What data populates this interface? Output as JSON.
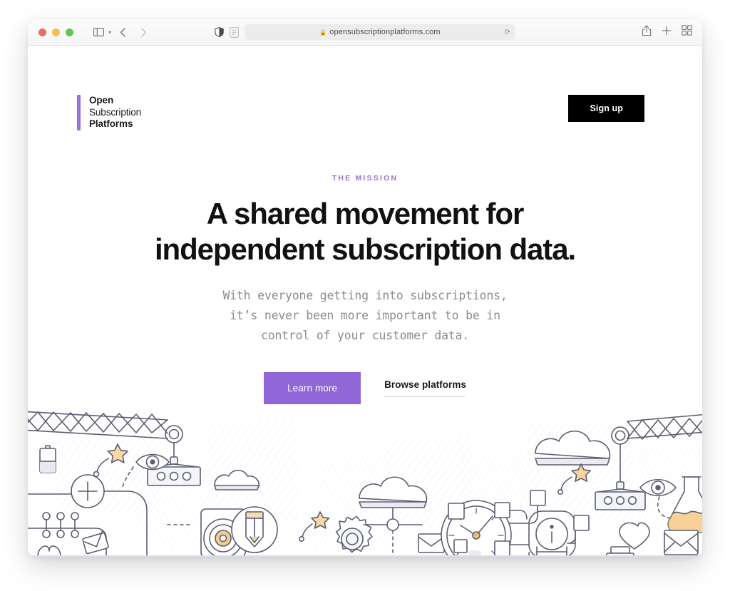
{
  "browser": {
    "traffic_lights": [
      "close",
      "minimize",
      "maximize"
    ],
    "sidebar_toggle_icon": "sidebar-icon",
    "sidebar_chevron_icon": "chevron-down-icon",
    "back_icon": "chevron-left-icon",
    "forward_icon": "chevron-right-icon",
    "privacy_icon": "shield-icon",
    "reader_icon": "reader-mode-icon",
    "url": "opensubscriptionplatforms.com",
    "lock_icon": "lock-icon",
    "reload_icon": "reload-icon",
    "share_icon": "share-icon",
    "new_tab_icon": "plus-icon",
    "tab_overview_icon": "tab-overview-icon"
  },
  "site": {
    "logo": {
      "line1": "Open",
      "line2": "Subscription",
      "line3": "Platforms",
      "accent_color": "#9a6fd8"
    },
    "signup_label": "Sign up"
  },
  "hero": {
    "eyebrow": "THE MISSION",
    "headline_line1": "A shared movement for",
    "headline_line2": "independent subscription data.",
    "sub_line1": "With everyone getting into subscriptions,",
    "sub_line2": "it’s never been more important to be in",
    "sub_line3": "control of your customer data.",
    "primary_cta": "Learn more",
    "secondary_cta": "Browse platforms",
    "primary_color": "#9166d8",
    "eyebrow_color": "#9a72cc"
  },
  "illustration": {
    "stroke_color": "#5b5d72",
    "accent_color": "#f3b95f",
    "fill_color": "#eef0f4",
    "icons": [
      "crane-truss-left",
      "battery-icon",
      "star-wand-icon",
      "eye-icon",
      "plus-circle-icon",
      "crane-hook-left",
      "cloud-icon",
      "node-dots-icon",
      "envelope-icon",
      "heart-icon",
      "speaker-icon",
      "pencil-circle-icon",
      "gear-icon",
      "cloud-network-icon",
      "clock-icon",
      "info-node-icon",
      "crane-truss-right",
      "flask-icon",
      "heart-outline-icon",
      "envelope-right-icon"
    ]
  }
}
